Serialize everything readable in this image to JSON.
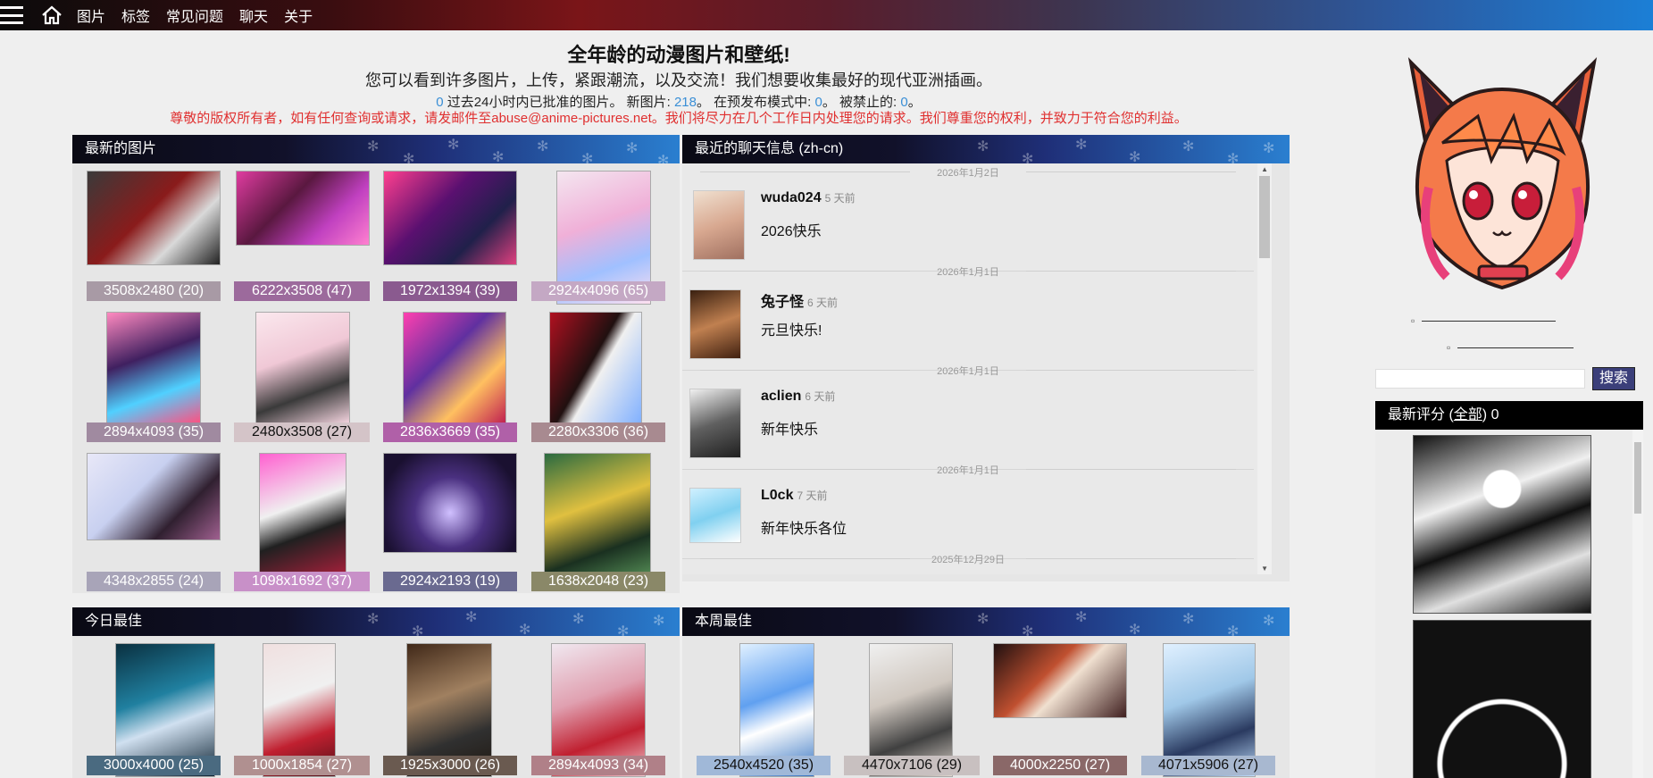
{
  "nav": {
    "links": [
      "图片",
      "标签",
      "常见问题",
      "聊天",
      "关于"
    ]
  },
  "header": {
    "title": "全年龄的动漫图片和壁纸!",
    "subtitle": "您可以看到许多图片，上传，紧跟潮流，以及交流！我们想要收集最好的现代亚洲插画。",
    "stats": {
      "approved_count": "0",
      "approved_text": "过去24小时内已批准的图片。",
      "new_label": "新图片:",
      "new_count": "218",
      "premod_label": "。 在预发布模式中:",
      "premod_count": "0",
      "banned_label": "。 被禁止的:",
      "banned_count": "0",
      "end": "。"
    },
    "notice": "尊敬的版权所有者，如有任何查询或请求，请发邮件至abuse@anime-pictures.net。我们将尽力在几个工作日内处理您的请求。我们尊重您的权利，并致力于符合您的利益。"
  },
  "latest": {
    "title": "最新的图片",
    "items": [
      "3508x2480 (20)",
      "6222x3508 (47)",
      "1972x1394 (39)",
      "2924x4096 (65)",
      "2894x4093 (35)",
      "2480x3508 (27)",
      "2836x3669 (35)",
      "2280x3306 (36)",
      "4348x2855 (24)",
      "1098x1692 (37)",
      "2924x2193 (19)",
      "1638x2048 (23)"
    ]
  },
  "chat": {
    "title": "最近的聊天信息 (zh-cn)",
    "entries": [
      {
        "date": "2026年1月2日",
        "user": "wuda024",
        "time": "5 天前",
        "message": "2026快乐"
      },
      {
        "date": "2026年1月1日",
        "user": "兔子怪",
        "time": "6 天前",
        "message": "元旦快乐!"
      },
      {
        "date": "2026年1月1日",
        "user": "aclien",
        "time": "6 天前",
        "message": "新年快乐"
      },
      {
        "date": "2026年1月1日",
        "user": "L0ck",
        "time": "7 天前",
        "message": "新年快乐各位"
      }
    ],
    "trailing_date": "2025年12月29日"
  },
  "today": {
    "title": "今日最佳",
    "items": [
      "3000x4000 (25)",
      "1000x1854 (27)",
      "1925x3000 (26)",
      "2894x4093 (34)"
    ]
  },
  "week": {
    "title": "本周最佳",
    "items": [
      "2540x4520 (35)",
      "4470x7106 (29)",
      "4000x2250 (27)",
      "4071x5906 (27)"
    ]
  },
  "search": {
    "button": "搜索",
    "placeholder": ""
  },
  "ratings": {
    "title_prefix": "最新评分 (",
    "title_link": "全部",
    "title_suffix": ") 0"
  }
}
